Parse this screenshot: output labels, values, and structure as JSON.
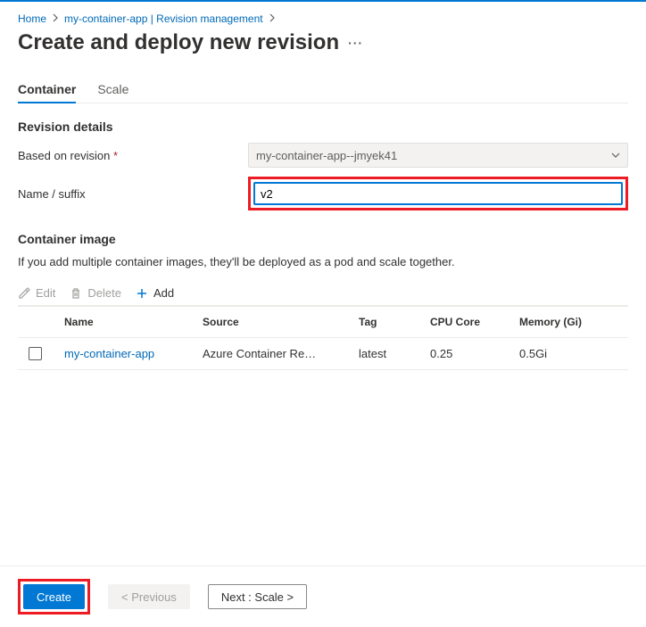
{
  "breadcrumbs": {
    "home": "Home",
    "parent": "my-container-app | Revision management"
  },
  "page": {
    "title": "Create and deploy new revision"
  },
  "tabs": {
    "container": "Container",
    "scale": "Scale"
  },
  "revision": {
    "header": "Revision details",
    "based_on_label": "Based on revision",
    "based_on_value": "my-container-app--jmyek41",
    "suffix_label": "Name / suffix",
    "suffix_value": "v2"
  },
  "image": {
    "header": "Container image",
    "subtext": "If you add multiple container images, they'll be deployed as a pod and scale together."
  },
  "toolbar": {
    "edit": "Edit",
    "delete": "Delete",
    "add": "Add"
  },
  "table": {
    "cols": {
      "name": "Name",
      "source": "Source",
      "tag": "Tag",
      "cpu": "CPU Core",
      "mem": "Memory (Gi)"
    },
    "rows": [
      {
        "name": "my-container-app",
        "source": "Azure Container Re…",
        "tag": "latest",
        "cpu": "0.25",
        "mem": "0.5Gi"
      }
    ]
  },
  "footer": {
    "create": "Create",
    "previous": "< Previous",
    "next": "Next : Scale >"
  }
}
